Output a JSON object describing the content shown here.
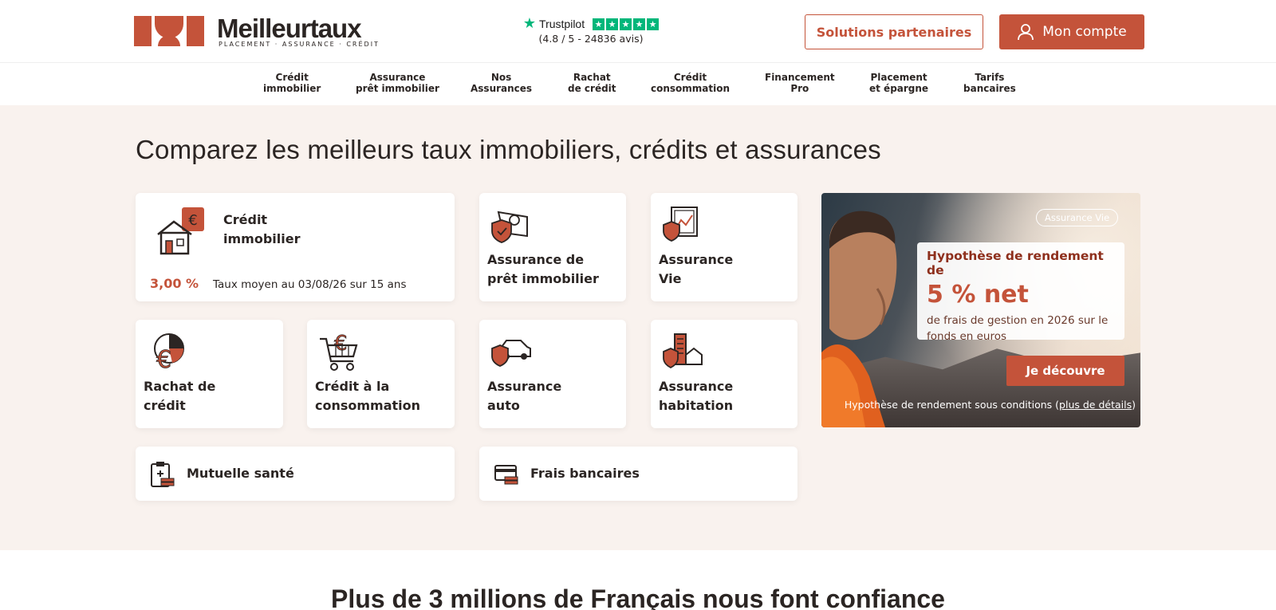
{
  "brand": {
    "name": "Meilleurtaux",
    "tagline": "PLACEMENT · ASSURANCE · CRÉDIT",
    "accent": "#c4533a"
  },
  "trustpilot": {
    "name": "Trustpilot",
    "score_text": "(4.8 / 5 - 24836 avis)",
    "color": "#00b67a"
  },
  "header": {
    "partners_label": "Solutions partenaires",
    "account_label": "Mon compte"
  },
  "nav": [
    "Crédit\nimmobilier",
    "Assurance\nprêt immobilier",
    "Nos\nAssurances",
    "Rachat\nde crédit",
    "Crédit\nconsommation",
    "Financement\nPro",
    "Placement\net épargne",
    "Tarifs\nbancaires"
  ],
  "hero": {
    "title": "Comparez les meilleurs taux immobiliers, crédits et assurances"
  },
  "cards": {
    "credit_immo": {
      "title": "Crédit\nimmobilier",
      "rate": "3,00 %",
      "rate_text": "Taux moyen au 03/08/26 sur 15 ans",
      "icon": "house-euro-icon"
    },
    "assurance_pret": {
      "title": "Assurance de\nprêt immobilier",
      "icon": "shield-house-icon"
    },
    "assurance_vie": {
      "title": "Assurance\nVie",
      "icon": "shield-chart-icon"
    },
    "rachat": {
      "title": "Rachat de\ncrédit",
      "icon": "euro-pie-icon"
    },
    "conso": {
      "title": "Crédit à la\nconsommation",
      "icon": "cart-euro-icon"
    },
    "auto": {
      "title": "Assurance\nauto",
      "icon": "shield-car-icon"
    },
    "habitation": {
      "title": "Assurance\nhabitation",
      "icon": "shield-building-icon"
    },
    "mutuelle": {
      "title": "Mutuelle santé",
      "icon": "clipboard-health-icon"
    },
    "frais": {
      "title": "Frais bancaires",
      "icon": "bank-card-icon"
    }
  },
  "promo": {
    "badge": "Assurance Vie",
    "headline": "Hypothèse de rendement de",
    "big": "5 % net",
    "sub": "de frais de gestion en 2026 sur le fonds en euros",
    "cta": "Je découvre",
    "note_prefix": "Hypothèse de rendement sous conditions (",
    "note_link": "plus de détails",
    "note_suffix": ")"
  },
  "trust_section": {
    "title": "Plus de 3 millions de Français nous font confiance"
  }
}
